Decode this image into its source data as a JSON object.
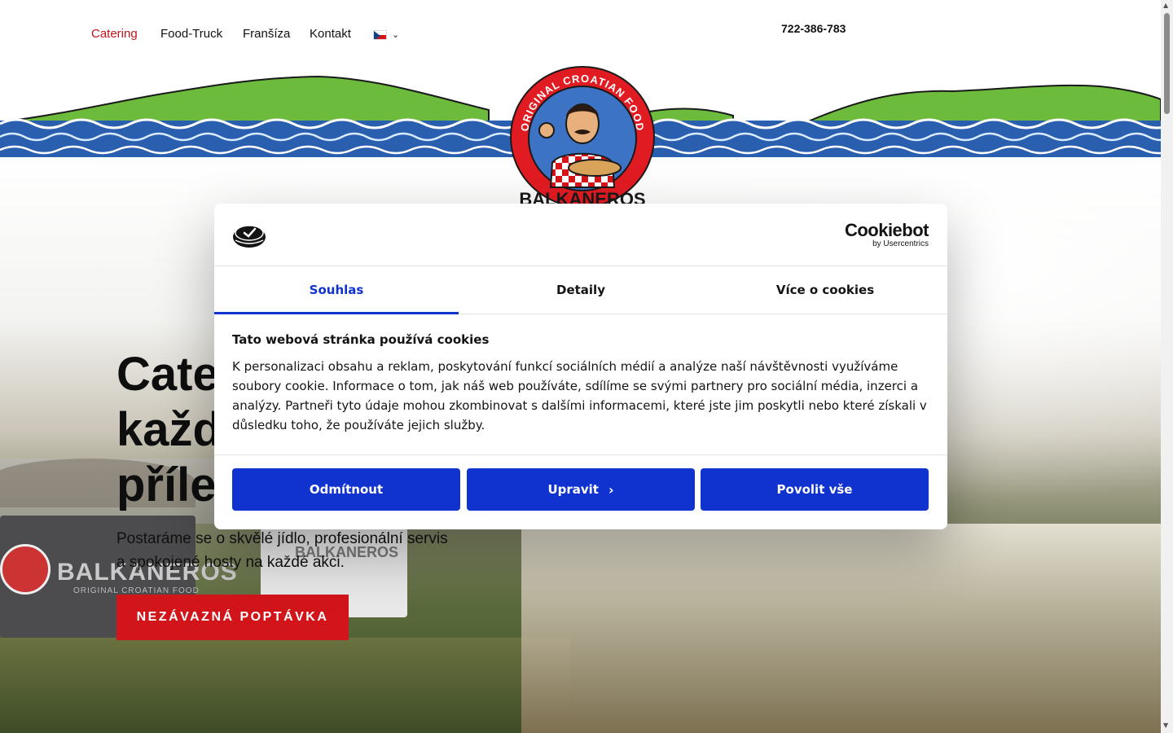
{
  "nav": {
    "links": [
      "Catering",
      "Food-Truck",
      "Franšíza",
      "Kontakt"
    ],
    "language_flag": "cz-flag-icon",
    "phone": "722-386-783"
  },
  "logo": {
    "ring_text": "ORIGINAL CROATIAN FOOD",
    "brand": "BALKANEROS"
  },
  "hero": {
    "title_lines": [
      "Cate",
      "každ",
      "příle"
    ],
    "subtitle_line1": "Postaráme se o skvělé jídlo, profesionální servis",
    "subtitle_line2": "a spokojené hosty na každé akci.",
    "cta": "NEZÁVAZNÁ POPTÁVKA",
    "truck_text": "BALKANEROS",
    "truck_sub": "ORIGINAL CROATIAN FOOD",
    "truck2_text": "BALKANEROS"
  },
  "cookie": {
    "brand": "Cookiebot",
    "brand_sub": "by Usercentrics",
    "tabs": [
      "Souhlas",
      "Detaily",
      "Více o cookies"
    ],
    "active_tab": "Souhlas",
    "heading": "Tato webová stránka používá cookies",
    "text": "K personalizaci obsahu a reklam, poskytování funkcí sociálních médií a analýze naší návštěvnosti využíváme soubory cookie. Informace o tom, jak náš web používáte, sdílíme se svými partnery pro sociální média, inzerci a analýzy. Partneři tyto údaje mohou zkombinovat s dalšími informacemi, které jste jim poskytli nebo které získali v důsledku toho, že používáte jejich služby.",
    "buttons": {
      "deny": "Odmítnout",
      "customize": "Upravit",
      "allow_all": "Povolit vše"
    },
    "accent": "#1032cf"
  },
  "colors": {
    "brand_red": "#d2151b",
    "nav_active": "#c0141c"
  }
}
